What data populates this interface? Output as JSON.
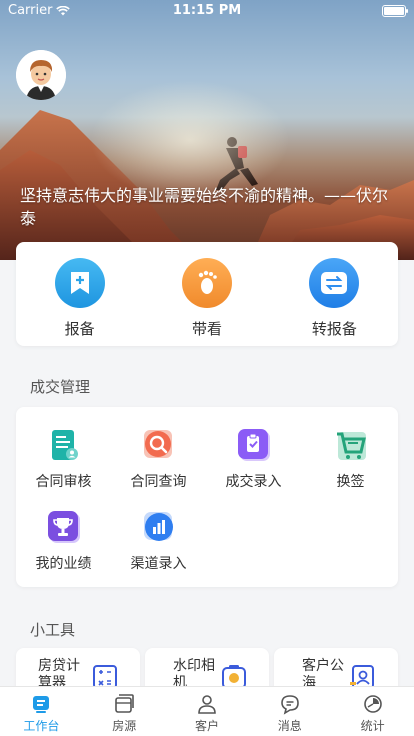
{
  "status_bar": {
    "carrier": "Carrier",
    "time": "11:15 PM"
  },
  "hero": {
    "quote": "坚持意志伟大的事业需要始终不渝的精神。——伏尔泰"
  },
  "quick_actions": [
    {
      "label": "报备",
      "icon": "bookmark-plus-icon",
      "color": "#2aa3e8"
    },
    {
      "label": "带看",
      "icon": "footprint-icon",
      "color": "#f59a3b"
    },
    {
      "label": "转报备",
      "icon": "swap-arrows-icon",
      "color": "#2f8ff0"
    }
  ],
  "deal_section": {
    "title": "成交管理",
    "items": [
      {
        "label": "合同审核",
        "icon": "contract-review-icon",
        "color": "#1fb3a8"
      },
      {
        "label": "合同查询",
        "icon": "contract-search-icon",
        "color": "#f26b4f"
      },
      {
        "label": "成交录入",
        "icon": "deal-entry-icon",
        "color": "#8b5cf6"
      },
      {
        "label": "换签",
        "icon": "cart-sign-icon",
        "color": "#24a37a"
      },
      {
        "label": "我的业绩",
        "icon": "trophy-icon",
        "color": "#7b4fe0"
      },
      {
        "label": "渠道录入",
        "icon": "chart-entry-icon",
        "color": "#2f7ef0"
      }
    ]
  },
  "tools_section": {
    "title": "小工具",
    "items": [
      {
        "label": "房贷计算器",
        "icon": "calculator-icon"
      },
      {
        "label": "水印相机",
        "icon": "camera-icon"
      },
      {
        "label": "客户公海",
        "icon": "customer-pool-icon"
      }
    ]
  },
  "tabbar": [
    {
      "label": "工作台",
      "icon": "workbench-icon",
      "active": true
    },
    {
      "label": "房源",
      "icon": "house-icon",
      "active": false
    },
    {
      "label": "客户",
      "icon": "person-icon",
      "active": false
    },
    {
      "label": "消息",
      "icon": "chat-icon",
      "active": false
    },
    {
      "label": "统计",
      "icon": "pie-chart-icon",
      "active": false
    }
  ],
  "colors": {
    "accent": "#1e9be8",
    "background": "#f4f5f7"
  }
}
